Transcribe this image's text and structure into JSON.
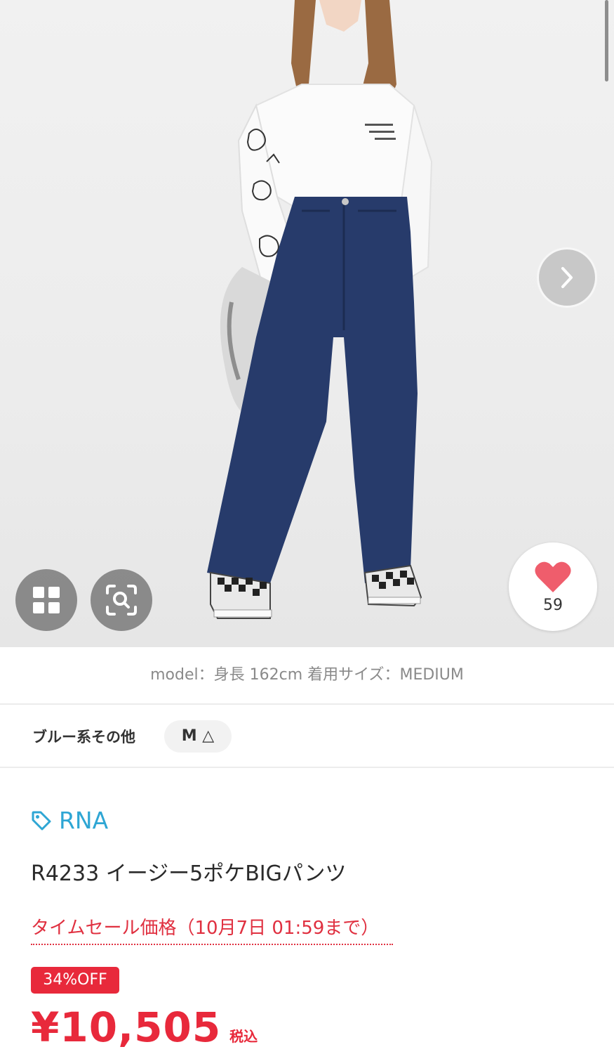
{
  "gallery": {
    "next_icon": "chevron-right-icon",
    "grid_icon": "grid-icon",
    "zoom_icon": "zoom-search-icon",
    "favorite_icon": "heart-icon",
    "favorite_count": "59"
  },
  "model_info": "model：身長 162cm 着用サイズ：MEDIUM",
  "variant": {
    "color": "ブルー系その他",
    "size": "M △"
  },
  "product": {
    "brand_icon": "tag-icon",
    "brand": "RNA",
    "name": "R4233 イージー5ポケBIGパンツ",
    "sale_label": "タイムセール価格（10月7日 01:59まで）",
    "discount": "34%OFF",
    "price": "¥10,505",
    "tax_note": "税込"
  },
  "colors": {
    "accent_red": "#e8293b",
    "brand_blue": "#2ea6d4",
    "heart_pink": "#ef5d6c"
  }
}
